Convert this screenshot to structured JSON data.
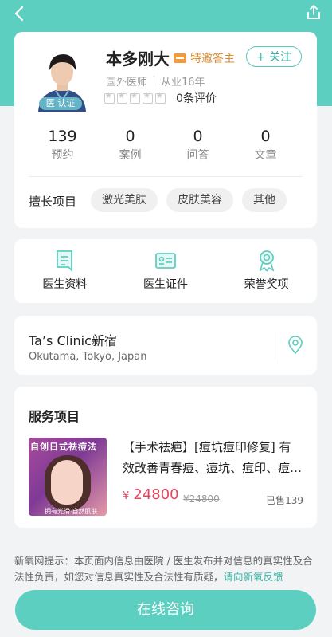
{
  "doctor": {
    "name": "本多刚大",
    "badge": "医 认证",
    "vip_label": "特邀答主",
    "follow_label": "关注",
    "region": "国外医师",
    "experience": "从业16年",
    "rating": 0,
    "review_text": "0条评价",
    "stats": [
      {
        "value": "139",
        "label": "预约"
      },
      {
        "value": "0",
        "label": "案例"
      },
      {
        "value": "0",
        "label": "问答"
      },
      {
        "value": "0",
        "label": "文章"
      }
    ],
    "skills_label": "擅长项目",
    "skills": [
      "激光美肤",
      "皮肤美容",
      "其他"
    ]
  },
  "menus": [
    {
      "label": "医生资料",
      "icon": "document-icon"
    },
    {
      "label": "医生证件",
      "icon": "id-card-icon"
    },
    {
      "label": "荣誉奖项",
      "icon": "award-icon"
    }
  ],
  "clinic": {
    "name": "Ta’s Clinic新宿",
    "address": "Okutama, Tokyo, Japan"
  },
  "service": {
    "section_title": "服务项目",
    "thumb_title": "自创日式祛痘法",
    "thumb_subtitle": "拥有光滑·自然肌肤",
    "description": "【手术祛疤】[痘坑痘印修复] 有效改善青春痘、痘坑、痘印、痘疤等问题",
    "currency": "¥",
    "price": "24800",
    "original_price": "¥24800",
    "sold": "已售139"
  },
  "notice": {
    "text": "新氧网提示：本页面内信息由医院 / 医生发布并对信息的真实性及合法性负责，如您对信息真实性及合法性有质疑，",
    "link": "请向新氧反馈"
  },
  "cta_label": "在线咨询",
  "colors": {
    "primary": "#5ccfc0",
    "price": "#e5455d",
    "vip": "#f19a3e"
  }
}
